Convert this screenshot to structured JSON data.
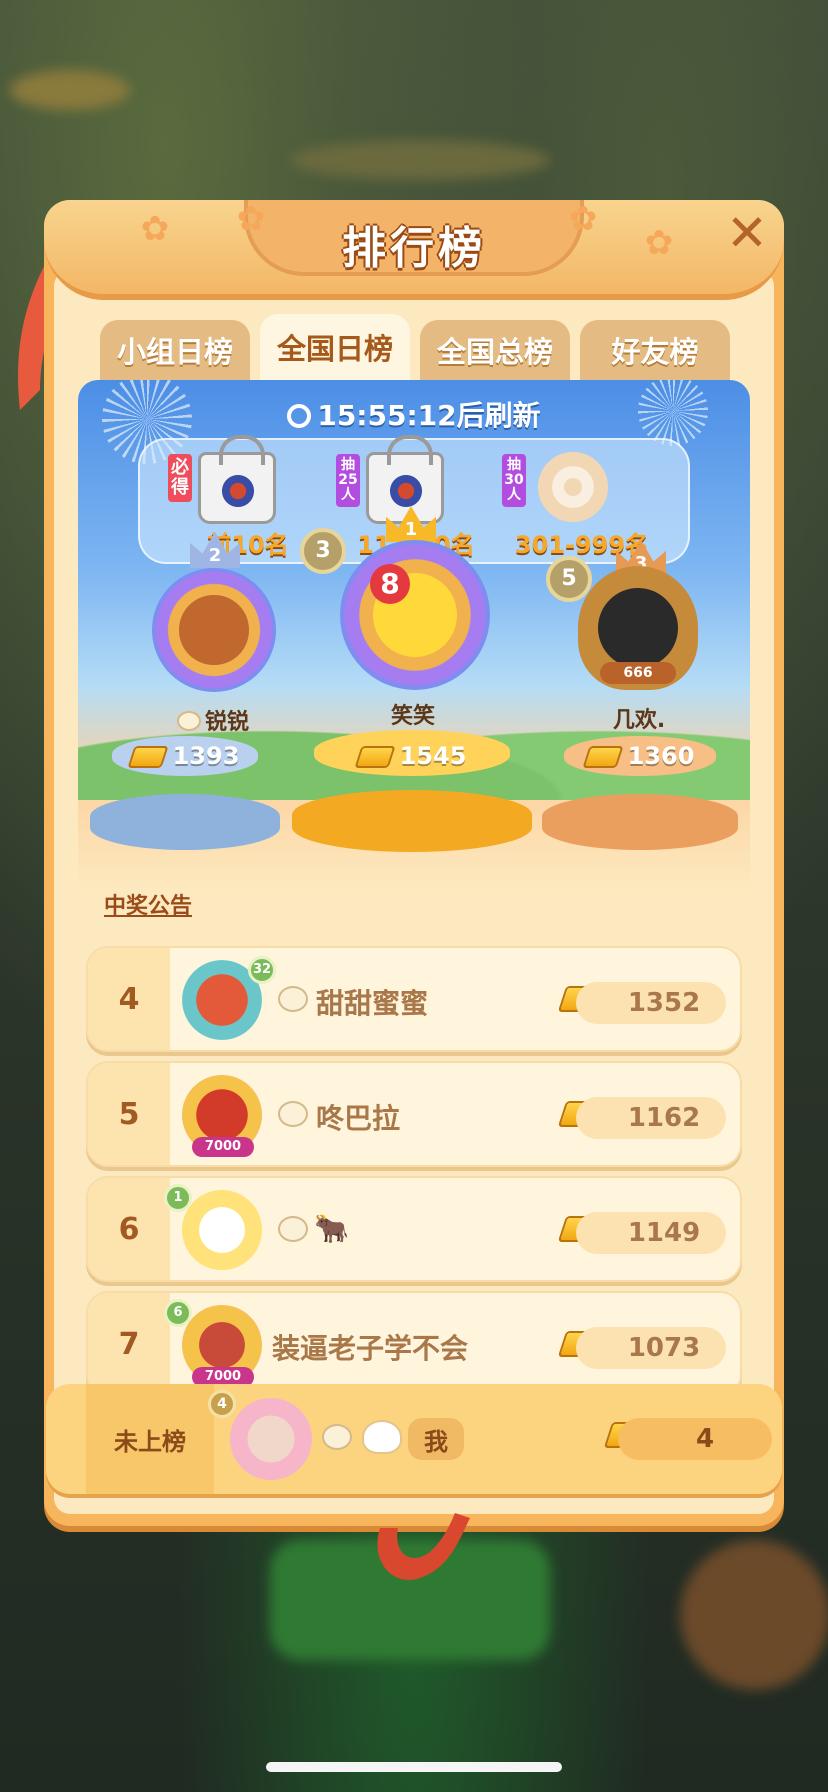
{
  "header": {
    "title": "排行榜"
  },
  "tabs": [
    {
      "label": "小组日榜",
      "active": false
    },
    {
      "label": "全国日榜",
      "active": true
    },
    {
      "label": "全国总榜",
      "active": false
    },
    {
      "label": "好友榜",
      "active": false
    }
  ],
  "timer": {
    "text": "15:55:12后刷新"
  },
  "rewards": [
    {
      "tag": "必得",
      "range": "前10名",
      "item": "bag-icon"
    },
    {
      "tag": "抽25人",
      "range": "11-300名",
      "item": "bag-icon"
    },
    {
      "tag": "抽30人",
      "range": "301-999名",
      "item": "neck-pillow-icon"
    }
  ],
  "podium": [
    {
      "place": "2",
      "level": "",
      "name": "锐锐",
      "score": "1393"
    },
    {
      "place": "1",
      "level": "3",
      "name": "笑笑",
      "score": "1545",
      "avatar_badge": "8"
    },
    {
      "place": "3",
      "level": "5",
      "name": "几欢.",
      "score": "1360",
      "avatar_badge": "666"
    }
  ],
  "announcement": "中奖公告",
  "rows": [
    {
      "rank": "4",
      "level": "32",
      "name": "甜甜蜜蜜",
      "score": "1352"
    },
    {
      "rank": "5",
      "level": "",
      "name": "咚巴拉",
      "score": "1162",
      "avatar_badge": "7000"
    },
    {
      "rank": "6",
      "level": "1",
      "name": "🐂",
      "score": "1149"
    },
    {
      "rank": "7",
      "level": "6",
      "name": "装逼老子学不会",
      "score": "1073",
      "avatar_badge": "7000"
    }
  ],
  "me": {
    "rank": "未上榜",
    "level": "4",
    "name": "我",
    "score": "4"
  },
  "colors": {
    "panel": "#f7b55c",
    "hero_top": "#4c8ee6",
    "gold": "#f3a712",
    "name_brown": "#a9784a"
  }
}
